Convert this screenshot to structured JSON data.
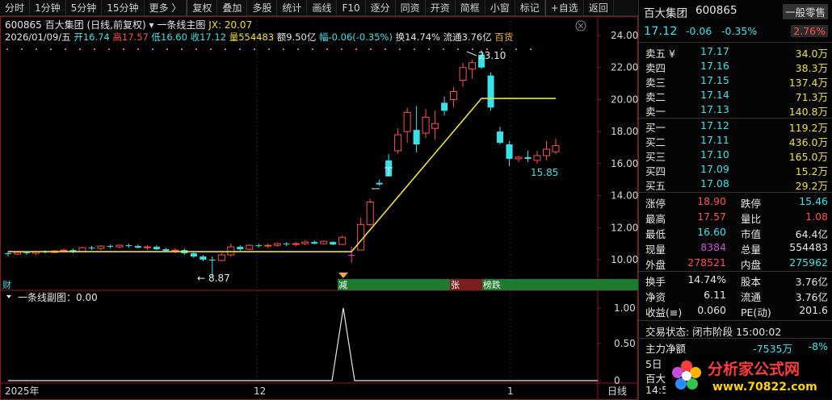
{
  "toolbar": {
    "items": [
      "分时",
      "1分钟",
      "5分钟",
      "15分钟",
      "更多 〉",
      "复权",
      "叠加",
      "多股",
      "统计",
      "画线",
      "F10",
      "逐分",
      "同资",
      "开资",
      "简框",
      "小窗",
      "标记",
      "+自选",
      "返回"
    ]
  },
  "header": {
    "code": "600865",
    "name": "百大集团",
    "period": "(日线,前复权)",
    "indicator": "一条线主图",
    "jx_label": "JX:",
    "jx_value": "20.07",
    "date": "2026/01/09/五",
    "open_label": "开",
    "open": "16.74",
    "high_label": "高",
    "high": "17.57",
    "low_label": "低",
    "low": "16.60",
    "close_label": "收",
    "close": "17.12",
    "vol_label": "量",
    "vol": "554483",
    "amt_label": "额",
    "amt": "9.50亿",
    "chg_label": "幅",
    "chg": "-0.06(-0.35%)",
    "turn_label": "换",
    "turn": "14.74%",
    "float_label": "流通",
    "float": "3.76亿",
    "tag": "百货"
  },
  "main_axis": {
    "labels": [
      "24.00",
      "22.00",
      "20.00",
      "18.00",
      "16.00",
      "14.00",
      "12.00",
      "10.00"
    ]
  },
  "annotations": {
    "high": "23.10",
    "low": "15.85",
    "min": "8.87",
    "badge1": "减",
    "badge2": "张",
    "badge3": "榜跌",
    "left_tag": "财"
  },
  "sub_chart": {
    "title": "一条线副图：0.00",
    "axis": [
      "1.00",
      "0.50",
      "0"
    ]
  },
  "time_axis": {
    "labels": [
      "2025年",
      "12",
      "1"
    ],
    "right": "日线"
  },
  "chart_data": [
    {
      "type": "candlestick",
      "title": "",
      "jx_line": "yellow line",
      "ylim": [
        8,
        25
      ],
      "candles": [
        [
          10.4,
          10.5,
          10.2,
          10.35
        ],
        [
          10.35,
          10.5,
          10.3,
          10.45
        ],
        [
          10.45,
          10.5,
          10.3,
          10.4
        ],
        [
          10.4,
          10.55,
          10.3,
          10.5
        ],
        [
          10.5,
          10.6,
          10.4,
          10.45
        ],
        [
          10.45,
          10.6,
          10.4,
          10.55
        ],
        [
          10.55,
          10.7,
          10.5,
          10.6
        ],
        [
          10.6,
          10.7,
          10.4,
          10.5
        ],
        [
          10.5,
          10.8,
          10.45,
          10.75
        ],
        [
          10.75,
          10.85,
          10.6,
          10.7
        ],
        [
          10.7,
          10.9,
          10.6,
          10.85
        ],
        [
          10.85,
          10.95,
          10.7,
          10.8
        ],
        [
          10.8,
          10.95,
          10.7,
          10.9
        ],
        [
          10.9,
          11.0,
          10.75,
          10.85
        ],
        [
          10.85,
          10.95,
          10.7,
          10.75
        ],
        [
          10.75,
          10.9,
          10.6,
          10.8
        ],
        [
          10.8,
          10.9,
          10.6,
          10.65
        ],
        [
          10.65,
          10.75,
          10.5,
          10.55
        ],
        [
          10.55,
          10.7,
          10.4,
          10.6
        ],
        [
          10.6,
          10.7,
          10.3,
          10.4
        ],
        [
          10.4,
          10.5,
          10.1,
          10.2
        ],
        [
          10.2,
          10.3,
          9.9,
          10.0
        ],
        [
          10.0,
          10.2,
          8.87,
          9.95
        ],
        [
          9.95,
          10.4,
          9.9,
          10.3
        ],
        [
          10.3,
          11.0,
          10.2,
          10.8
        ],
        [
          10.8,
          10.9,
          10.55,
          10.65
        ],
        [
          10.65,
          10.95,
          10.6,
          10.9
        ],
        [
          10.9,
          11.0,
          10.75,
          10.85
        ],
        [
          10.85,
          11.0,
          10.7,
          10.9
        ],
        [
          10.9,
          11.05,
          10.8,
          11.0
        ],
        [
          11.0,
          11.1,
          10.85,
          10.95
        ],
        [
          10.95,
          11.1,
          10.85,
          11.0
        ],
        [
          11.0,
          11.2,
          10.9,
          11.1
        ],
        [
          11.1,
          11.2,
          10.95,
          11.0
        ],
        [
          11.0,
          11.2,
          10.95,
          11.15
        ],
        [
          11.1,
          11.15,
          10.9,
          10.95
        ],
        [
          10.95,
          11.5,
          10.9,
          11.4
        ],
        [
          10.3,
          10.8,
          9.8,
          10.3
        ],
        [
          10.6,
          12.6,
          10.6,
          12.2
        ],
        [
          12.2,
          13.8,
          12.1,
          13.6
        ],
        [
          14.8,
          15.0,
          14.6,
          14.7
        ],
        [
          16.2,
          16.6,
          15.2,
          15.2
        ],
        [
          16.8,
          18.2,
          16.6,
          17.8
        ],
        [
          18.0,
          19.5,
          17.3,
          19.2
        ],
        [
          18.1,
          19.6,
          16.7,
          17.2
        ],
        [
          17.9,
          19.4,
          17.6,
          18.9
        ],
        [
          18.2,
          19.3,
          17.5,
          18.5
        ],
        [
          19.8,
          20.2,
          19.0,
          19.3
        ],
        [
          20.0,
          20.8,
          19.5,
          20.5
        ],
        [
          21.2,
          22.3,
          20.8,
          22.0
        ],
        [
          21.9,
          22.5,
          21.3,
          22.3
        ],
        [
          22.8,
          23.1,
          21.9,
          22.0
        ],
        [
          21.5,
          21.7,
          19.3,
          19.5
        ],
        [
          18.0,
          18.3,
          17.2,
          17.3
        ],
        [
          17.2,
          17.4,
          15.85,
          16.3
        ],
        [
          16.3,
          16.5,
          16.1,
          16.4
        ],
        [
          16.4,
          16.8,
          16.1,
          16.3
        ],
        [
          16.2,
          16.8,
          16.0,
          16.5
        ],
        [
          16.5,
          17.4,
          16.2,
          16.9
        ],
        [
          16.74,
          17.57,
          16.6,
          17.12
        ]
      ]
    },
    {
      "type": "line",
      "title": "",
      "ylim": [
        0,
        1.2
      ],
      "values": [
        0,
        1,
        0
      ]
    }
  ],
  "rp": {
    "title_name": "百大集团",
    "title_code": "600865",
    "title_btn": "一般零售",
    "price": "17.12",
    "chg": "-0.06",
    "pct": "-0.35%",
    "rate": "2.76%",
    "asks": [
      {
        "l": "卖五 ¥",
        "p": "17.17",
        "v": "34.0万"
      },
      {
        "l": "卖四",
        "p": "17.16",
        "v": "38.3万"
      },
      {
        "l": "卖三",
        "p": "17.15",
        "v": "137.4万"
      },
      {
        "l": "卖二",
        "p": "17.14",
        "v": "71.3万"
      },
      {
        "l": "卖一",
        "p": "17.13",
        "v": "140.8万"
      }
    ],
    "bids": [
      {
        "l": "买一",
        "p": "17.12",
        "v": "119.2万"
      },
      {
        "l": "买二",
        "p": "17.11",
        "v": "436.0万"
      },
      {
        "l": "买三",
        "p": "17.10",
        "v": "165.0万"
      },
      {
        "l": "买四",
        "p": "17.09",
        "v": "15.2万"
      },
      {
        "l": "买五",
        "p": "17.08",
        "v": "29.2万"
      }
    ],
    "stats": [
      {
        "l1": "涨停",
        "v1": "18.90",
        "l2": "跌停",
        "v2": "15.46"
      },
      {
        "l1": "最高",
        "v1": "17.57",
        "l2": "量比",
        "v2": "1.08"
      },
      {
        "l1": "最低",
        "v1": "16.60",
        "l2": "市值",
        "v2": "64.4亿"
      },
      {
        "l1": "现量",
        "v1": "8384",
        "l2": "总量",
        "v2": "554483"
      },
      {
        "l1": "外盘",
        "v1": "278521",
        "l2": "内盘",
        "v2": "275962"
      }
    ],
    "stats2": [
      {
        "l1": "换手",
        "v1": "14.74%",
        "l2": "股本",
        "v2": "3.76亿"
      },
      {
        "l1": "净资",
        "v1": "6.11",
        "l2": "流通",
        "v2": "3.76亿"
      },
      {
        "l1": "收益(≡)",
        "v1": "0.060",
        "l2": "PE(动)",
        "v2": "201.6"
      }
    ],
    "trade_state": "交易状态: 闭市阶段 15:00:02",
    "main_net_label": "主力净额",
    "main_net": "-7535万",
    "main_net_pct": "-8%",
    "day_label": "5日",
    "bottom1": "百大",
    "bottom2": "14:5"
  },
  "logo": {
    "text": "分析家公式网",
    "url": "www.70822.com"
  },
  "colors": {
    "up": "#ff4f4f",
    "down": "#37e3ea",
    "jx": "#f2e030",
    "bg": "#000000"
  }
}
